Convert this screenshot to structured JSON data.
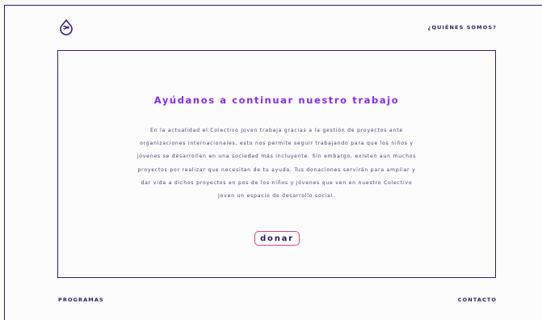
{
  "header": {
    "logo_icon": "drop-infinity-logo-icon",
    "nav_about": "¿QUIÉNES SOMOS?"
  },
  "main": {
    "title": "Ayúdanos a continuar nuestro trabajo",
    "description": "En la actualidad el Colectivo Joven trabaja gracias a la gestión de proyectos ante organizaciones internacionales, esto nos permite seguir trabajando para que los niños y jóvenes se desarrollen en una sociedad más incluyente. Sin embargo, existen aun muchos proyectos por realizar que necesitan de tu ayuda. Tus donaciones servirán para ampliar y dar vida a dichos proyectos en pos de los niños y jóvenes que ven en nuestro Colectivo Joven un espacio de desarrollo social.",
    "donate_label": "donar"
  },
  "footer": {
    "nav_programs": "PROGRAMAS",
    "nav_contact": "CONTACTO"
  },
  "colors": {
    "accent_purple": "#8a2be2",
    "button_border_pink": "#e0457b",
    "frame_navy": "#3a1a7a",
    "text_dark": "#2a1a5e"
  }
}
